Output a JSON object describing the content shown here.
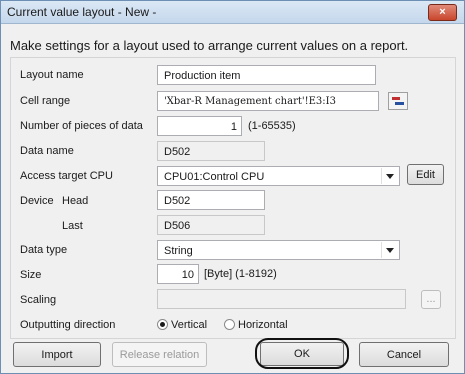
{
  "window": {
    "title": "Current value layout - New -",
    "close_glyph": "×"
  },
  "instruction": "Make settings for a layout used to arrange current values on a report.",
  "form": {
    "layout_name": {
      "label": "Layout name",
      "value": "Production item"
    },
    "cell_range": {
      "label": "Cell range",
      "value": "'Xbar-R Management chart'!E3:I3",
      "icon": "range-select-icon"
    },
    "pieces": {
      "label": "Number of pieces of data",
      "value": "1",
      "range": "(1-65535)"
    },
    "data_name": {
      "label": "Data name",
      "value": "D502"
    },
    "access_cpu": {
      "label": "Access target CPU",
      "value": "CPU01:Control CPU",
      "edit_label": "Edit"
    },
    "device": {
      "label": "Device",
      "head_label": "Head",
      "head_value": "D502",
      "last_label": "Last",
      "last_value": "D506"
    },
    "data_type": {
      "label": "Data type",
      "value": "String"
    },
    "size": {
      "label": "Size",
      "value": "10",
      "unit": "[Byte] (1-8192)"
    },
    "scaling": {
      "label": "Scaling",
      "value": "",
      "browse_label": "..."
    },
    "direction": {
      "label": "Outputting direction",
      "options": [
        "Vertical",
        "Horizontal"
      ],
      "selected": "Vertical"
    }
  },
  "buttons": {
    "import": "Import",
    "release": "Release relation",
    "ok": "OK",
    "cancel": "Cancel"
  }
}
